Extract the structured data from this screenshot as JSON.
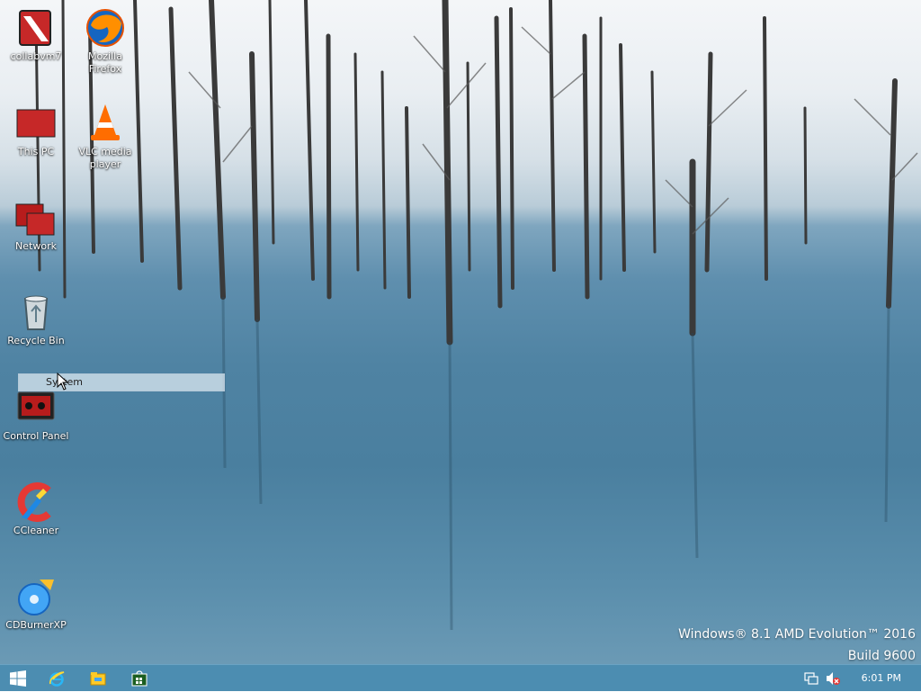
{
  "desktop": {
    "icons": [
      {
        "label": "collabvm7",
        "icon": "collabvm-icon"
      },
      {
        "label": "Mozilla\nFirefox",
        "icon": "firefox-icon"
      },
      {
        "label": "This PC",
        "icon": "this-pc-icon"
      },
      {
        "label": "VLC media\nplayer",
        "icon": "vlc-icon"
      },
      {
        "label": "Network",
        "icon": "network-icon"
      },
      {
        "label": "Recycle Bin",
        "icon": "recycle-bin-icon"
      },
      {
        "label": "Control Panel",
        "icon": "control-panel-icon"
      },
      {
        "label": "CCleaner",
        "icon": "ccleaner-icon"
      },
      {
        "label": "CDBurnerXP",
        "icon": "cdburnerxp-icon"
      }
    ],
    "rename_text": "System",
    "watermark": {
      "line1": "Windows® 8.1 AMD Evolution™ 2016",
      "line2": "Build 9600"
    }
  },
  "taskbar": {
    "start": "start-icon",
    "pinned": [
      "internet-explorer-icon",
      "file-explorer-icon",
      "store-icon"
    ],
    "tray": [
      "network-tray-icon",
      "volume-muted-icon"
    ],
    "clock": "6:01 PM"
  },
  "colors": {
    "taskbar": "#4c8db1",
    "water": "#4f83a3",
    "snow": "#eef2f5"
  }
}
